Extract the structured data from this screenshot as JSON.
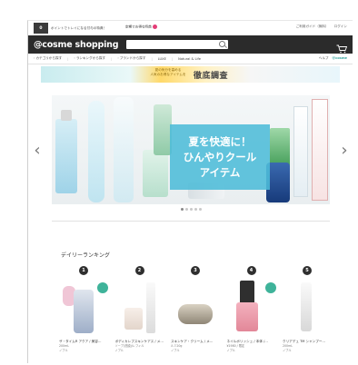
{
  "util": {
    "points_label": "0",
    "promo_text": "ポイントでトレイになる付与の特典！",
    "gift_text": "定期でお得な特典",
    "right_links": [
      "ご利用ガイド（無料）",
      "ログイン"
    ]
  },
  "header": {
    "logo": "@cosme shopping",
    "search_placeholder": ""
  },
  "nav": {
    "items": [
      "カテゴリから探す",
      "ランキングから探す",
      "ブランドから探す",
      "LUXE",
      "Natural & Life"
    ],
    "help": "ヘルプ",
    "brand_badge": "@cosme"
  },
  "promo_strip": {
    "sub_text_1": "夏の気分を高める",
    "sub_text_2": "人気のお得なアイテムを",
    "title": "徹底調査"
  },
  "carousel": {
    "caption_lines": [
      "夏を快適に！",
      "ひんやりクール",
      "アイテム"
    ],
    "slide_count": 5,
    "active_index": 0,
    "prev_icon": "chevron-left-icon",
    "next_icon": "chevron-right-icon"
  },
  "ranking": {
    "title": "デイリーランキング",
    "items": [
      {
        "rank": "1",
        "name": "ザ・タイムR アクア / 美容…",
        "meta1": "200mL",
        "meta2": "ノブル"
      },
      {
        "rank": "2",
        "name": "ボディカレブスキンケアス / メ…",
        "meta1": "ソープ(洗顔)/レフィル",
        "meta2": "ノブル"
      },
      {
        "rank": "3",
        "name": "スキンケア・クリーム / メ…",
        "meta1": "ルミ20g",
        "meta2": "ノブル"
      },
      {
        "rank": "4",
        "name": "ネイルポリッシュ / 本体 /…",
        "meta1": "¥1980 / 限定",
        "meta2": "ノブル"
      },
      {
        "rank": "5",
        "name": "クリアデュ TM シャンプー…",
        "meta1": "200mL",
        "meta2": "ノブル"
      }
    ]
  },
  "colors": {
    "header_bg": "#2b2b2b",
    "caption_bg": "#4dbcd8",
    "accent_green": "#3aa6a0",
    "notif_pink": "#e33d77"
  }
}
